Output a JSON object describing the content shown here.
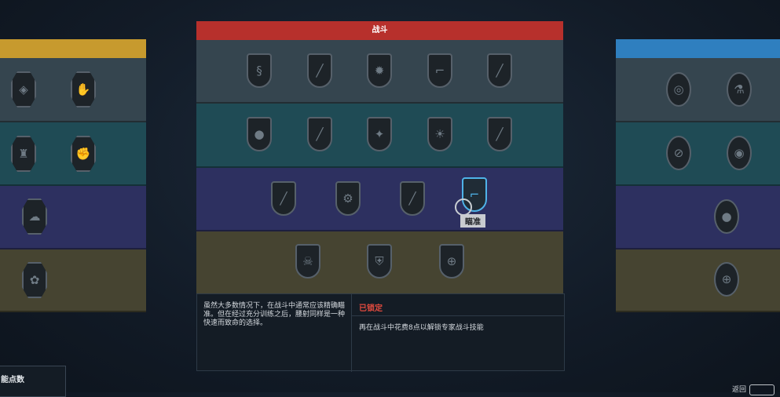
{
  "center_panel": {
    "title": "战斗"
  },
  "tooltip": {
    "text": "瞄准"
  },
  "info": {
    "description": "虽然大多数情况下，在战斗中通常应该精确瞄准。但在经过充分训练之后，腰射同样是一种快速而致命的选择。",
    "status": "已锁定",
    "unlock_requirement": "再在战斗中花费8点以解锁专家战斗技能"
  },
  "points": {
    "label": "能点数"
  },
  "back": {
    "label": "返回"
  },
  "colors": {
    "physical": "#c79a2e",
    "combat": "#b7302c",
    "science": "#2f7fbf",
    "selected": "#4fb3e8",
    "locked": "#e04a3e"
  },
  "icons": {
    "combat_tier1": [
      "dragon-icon",
      "knife-icon",
      "burst-icon",
      "pistol-icon",
      "rifle-icon"
    ],
    "combat_tier2": [
      "grenade-icon",
      "shotgun-icon",
      "sparkle-icon",
      "sunburst-icon",
      "assault-rifle-icon"
    ],
    "combat_tier3": [
      "sniper-icon",
      "heavy-weapon-icon",
      "rifle-scope-icon",
      "revolver-icon"
    ],
    "combat_tier4": [
      "skull-emblem-icon",
      "armor-icon",
      "crosshair-icon"
    ]
  }
}
